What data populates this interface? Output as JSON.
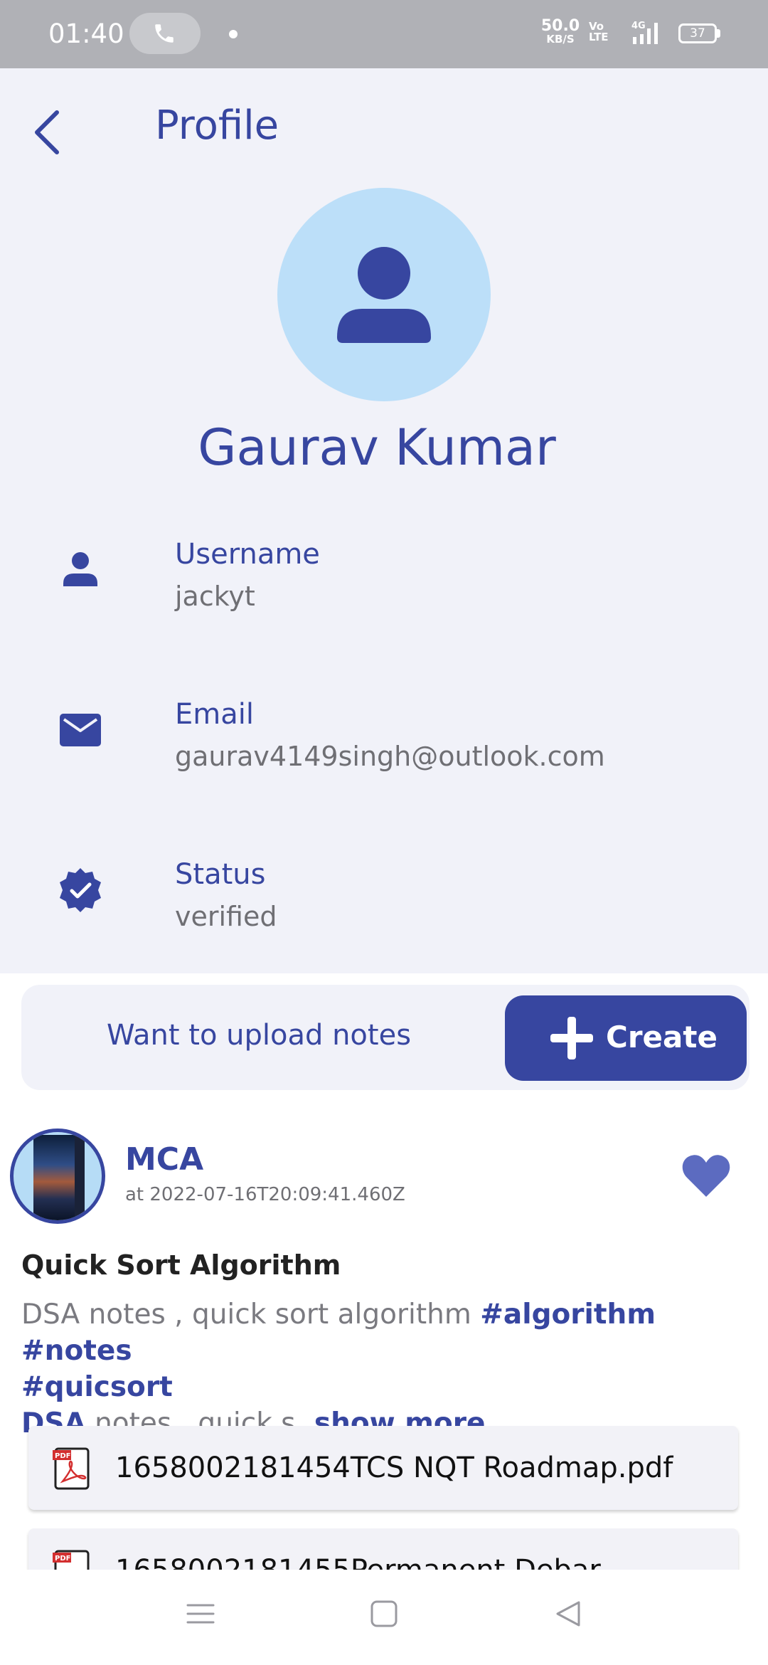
{
  "status_bar": {
    "time": "01:40",
    "net_speed_value": "50.0",
    "net_speed_unit": "KB/S",
    "volte": "Vo LTE",
    "network": "4G",
    "battery": "37"
  },
  "header": {
    "title": "Profile"
  },
  "profile": {
    "name": "Gaurav Kumar",
    "fields": [
      {
        "label": "Username",
        "value": "jackyt"
      },
      {
        "label": "Email",
        "value": "gaurav4149singh@outlook.com"
      },
      {
        "label": "Status",
        "value": "verified"
      }
    ]
  },
  "upload": {
    "prompt": "Want to upload notes",
    "button_label": "Create"
  },
  "post": {
    "group": "MCA",
    "timestamp": "at 2022-07-16T20:09:41.460Z",
    "title": "Quick Sort Algorithm",
    "desc_text": "DSA notes , quick sort algorithm",
    "tags": [
      "#algorithm",
      "#notes",
      "#quicsort"
    ],
    "desc_tail_bold": "DSA",
    "desc_tail": "notes , quick s",
    "show_more": "show more",
    "files": [
      {
        "name": "1658002181454TCS NQT Roadmap.pdf"
      },
      {
        "name": "1658002181455Permanent Debar"
      }
    ],
    "pdf_badge": "PDF"
  },
  "colors": {
    "accent": "#3746a0",
    "background": "#f1f2f9",
    "avatar_bg": "#bcdff9",
    "heart": "#5c6bc0"
  }
}
